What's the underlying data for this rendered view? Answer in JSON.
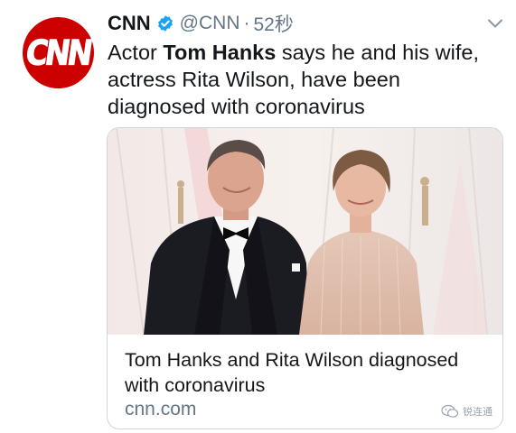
{
  "tweet": {
    "author_name": "CNN",
    "handle": "@CNN",
    "separator": "·",
    "timestamp": "52秒",
    "text_prefix": "Actor ",
    "text_bold": "Tom Hanks",
    "text_suffix": " says he and his wife,\nactress Rita Wilson, have been\ndiagnosed with coronavirus",
    "avatar_logo": "CNN"
  },
  "card": {
    "title": "Tom Hanks and Rita Wilson diagnosed with coronavirus",
    "domain": "cnn.com"
  },
  "watermark": {
    "text": "锐连通"
  },
  "icons": {
    "verified": "verified-badge-icon",
    "menu": "chevron-down-icon"
  },
  "colors": {
    "brand_red": "#cc0000",
    "verified_blue": "#1da1f2",
    "secondary_text": "#657786",
    "border": "#ccd6dd"
  }
}
